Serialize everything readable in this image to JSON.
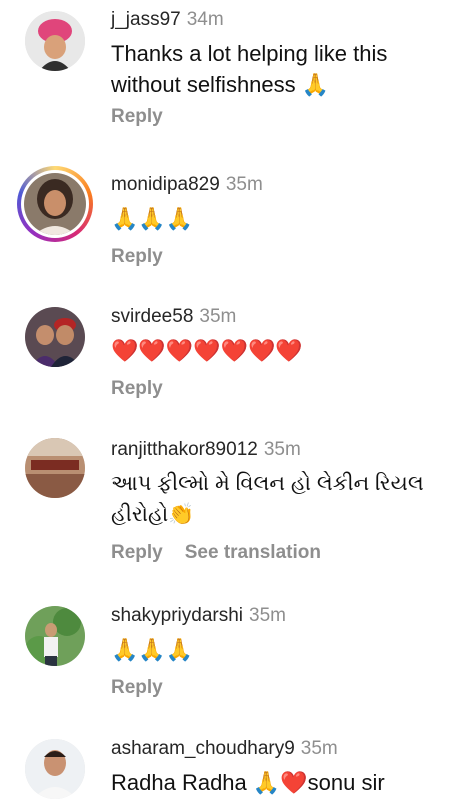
{
  "comments": [
    {
      "username": "j_jass97",
      "time": "34m",
      "text": "Thanks a lot helping like this without selfishness 🙏",
      "reply_label": "Reply"
    },
    {
      "username": "monidipa829",
      "time": "35m",
      "text": "🙏🙏🙏",
      "reply_label": "Reply"
    },
    {
      "username": "svirdee58",
      "time": "35m",
      "text": "❤️❤️❤️❤️❤️❤️❤️",
      "reply_label": "Reply"
    },
    {
      "username": "ranjitthakor89012",
      "time": "35m",
      "text": "આપ ફીલ્મો મે  વિલન હો લેકીન રિયલ હીરોહો👏",
      "reply_label": "Reply",
      "see_translation_label": "See translation"
    },
    {
      "username": "shakypriydarshi",
      "time": "35m",
      "text": "🙏🙏🙏",
      "reply_label": "Reply"
    },
    {
      "username": "asharam_choudhary9",
      "time": "35m",
      "text": "Radha Radha 🙏❤️sonu sir"
    }
  ],
  "colors": {
    "muted": "#8e8e8e",
    "text": "#262626",
    "story_ring": "#d62976"
  }
}
